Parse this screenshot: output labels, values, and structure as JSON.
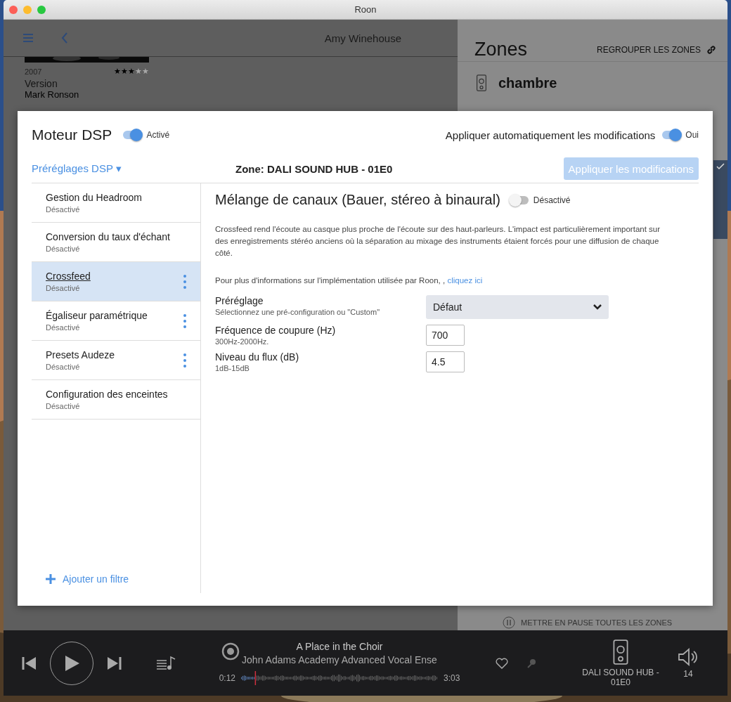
{
  "window": {
    "title": "Roon"
  },
  "background": {
    "header": {
      "title": "Amy Winehouse"
    },
    "album": {
      "year": "2007",
      "stars": 3,
      "title": "Version",
      "artist": "Mark Ronson"
    },
    "zones": {
      "title": "Zones",
      "group_action": "REGROUPER LES ZONES",
      "zone_name": "chambre",
      "pause_all": "METTRE EN PAUSE TOUTES LES ZONES"
    }
  },
  "dsp": {
    "title": "Moteur DSP",
    "engine_toggle": {
      "label": "Activé",
      "on": true
    },
    "auto_apply": {
      "label": "Appliquer automatiquement les modifications",
      "toggle_label": "Oui",
      "on": true
    },
    "presets_link": "Préréglages DSP ▾",
    "zone": "Zone: DALI SOUND HUB - 01E0",
    "apply_button": {
      "label": "Appliquer les modifications",
      "disabled": true
    },
    "filters": [
      {
        "name": "Gestion du Headroom",
        "status": "Désactivé",
        "selected": false,
        "menu": false
      },
      {
        "name": "Conversion du taux d'échant",
        "status": "Désactivé",
        "selected": false,
        "menu": false
      },
      {
        "name": "Crossfeed",
        "status": "Désactivé",
        "selected": true,
        "menu": true
      },
      {
        "name": "Égaliseur paramétrique",
        "status": "Désactivé",
        "selected": false,
        "menu": true
      },
      {
        "name": "Presets Audeze",
        "status": "Désactivé",
        "selected": false,
        "menu": true
      },
      {
        "name": "Configuration des enceintes",
        "status": "Désactivé",
        "selected": false,
        "menu": false
      }
    ],
    "add_filter": "Ajouter un filtre",
    "detail": {
      "title": "Mélange de canaux (Bauer, stéreo à binaural)",
      "toggle": {
        "label": "Désactivé",
        "on": false
      },
      "description": "Crossfeed rend l'écoute au casque plus proche de l'écoute sur des haut-parleurs. L'impact est particulièrement important sur des enregistrements stéréo anciens où la séparation au mixage des instruments étaient forcés pour une diffusion de chaque côté.",
      "info": "Pour plus d'informations sur l'implémentation utilisée par Roon, ,",
      "info_link": "cliquez ici",
      "settings": [
        {
          "kind": "select",
          "label": "Préréglage",
          "hint": "Sélectionnez une pré-configuration ou \"Custom\"",
          "value": "Défaut"
        },
        {
          "kind": "number",
          "label": "Fréquence de coupure (Hz)",
          "hint": "300Hz-2000Hz.",
          "value": "700"
        },
        {
          "kind": "number",
          "label": "Niveau du flux (dB)",
          "hint": "1dB-15dB",
          "value": "4.5"
        }
      ]
    }
  },
  "player": {
    "title": "A Place in the Choir",
    "artist": "John Adams Academy Advanced Vocal Ense",
    "elapsed": "0:12",
    "duration": "3:03",
    "progress": {
      "level": 0.07
    },
    "zone": "DALI SOUND HUB - 01E0",
    "volume": "14"
  }
}
